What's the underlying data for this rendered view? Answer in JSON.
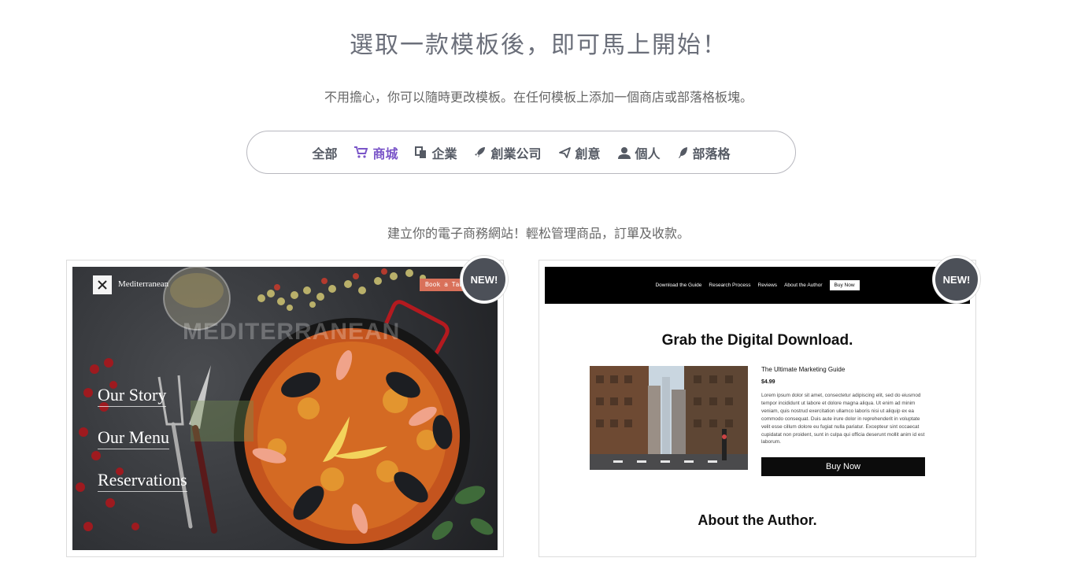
{
  "header": {
    "title": "選取一款模板後，即可馬上開始！",
    "subtitle": "不用擔心，你可以隨時更改模板。在任何模板上添加一個商店或部落格板塊。"
  },
  "filters": {
    "items": [
      {
        "label": "全部",
        "icon": "none"
      },
      {
        "label": "商城",
        "icon": "cart-icon",
        "active": true
      },
      {
        "label": "企業",
        "icon": "copy-icon"
      },
      {
        "label": "創業公司",
        "icon": "rocket-icon"
      },
      {
        "label": "創意",
        "icon": "paper-plane-icon"
      },
      {
        "label": "個人",
        "icon": "user-icon"
      },
      {
        "label": "部落格",
        "icon": "feather-icon"
      }
    ],
    "active_color": "#7a55c8"
  },
  "category": {
    "description": "建立你的電子商務網站！輕松管理商品，訂單及收款。"
  },
  "templates": [
    {
      "badge": "NEW!",
      "logo_name": "Mediterranean",
      "book_button": "Book a Table",
      "watermark": "MEDITERRANEAN",
      "menu": [
        "Our Story",
        "Our Menu",
        "Reservations"
      ]
    },
    {
      "badge": "NEW!",
      "nav": [
        "Download the Guide",
        "Research Process",
        "Reviews",
        "About the Author"
      ],
      "nav_button": "Buy Now",
      "heading": "Grab the Digital Download.",
      "product_title": "The Ultimate Marketing Guide",
      "price": "$4.99",
      "body": "Lorem ipsum dolor sit amet, consectetur adipiscing elit, sed do eiusmod tempor incididunt ut labore et dolore magna aliqua. Ut enim ad minim veniam, quis nostrud exercitation ullamco laboris nisi ut aliquip ex ea commodo consequat. Duis aute irure dolor in reprehenderit in voluptate velit esse cillum dolore eu fugiat nulla pariatur. Excepteur sint occaecat cupidatat non proident, sunt in culpa qui officia deserunt mollit anim id est laborum.",
      "buy_button": "Buy Now",
      "about_heading": "About the Author."
    }
  ]
}
